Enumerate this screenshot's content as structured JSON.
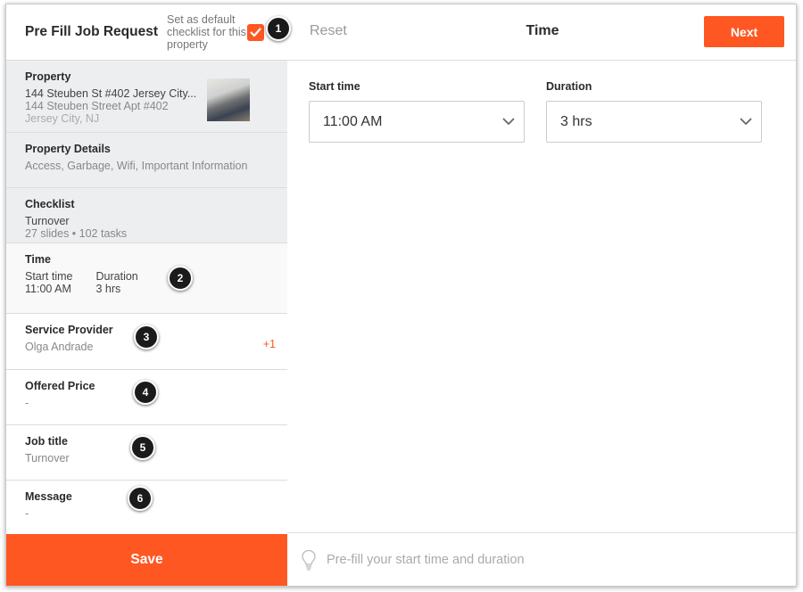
{
  "left": {
    "title": "Pre Fill Job Request",
    "default_checkbox_label": "Set as default checklist for this property",
    "default_checked": true,
    "property": {
      "title": "Property",
      "name": "144 Steuben St #402 Jersey City...",
      "address": "144 Steuben Street Apt #402",
      "city": "Jersey City, NJ"
    },
    "property_details": {
      "title": "Property Details",
      "summary": "Access, Garbage, Wifi, Important Information"
    },
    "checklist": {
      "title": "Checklist",
      "name": "Turnover",
      "summary": "27 slides • 102 tasks"
    },
    "time": {
      "title": "Time",
      "start_label": "Start time",
      "start_value": "11:00 AM",
      "duration_label": "Duration",
      "duration_value": "3 hrs"
    },
    "service_provider": {
      "title": "Service Provider",
      "value": "Olga Andrade",
      "extra_count": "+1"
    },
    "offered_price": {
      "title": "Offered Price",
      "value": "-"
    },
    "job_title": {
      "title": "Job title",
      "value": "Turnover"
    },
    "message": {
      "title": "Message",
      "value": "-"
    },
    "save_label": "Save"
  },
  "right": {
    "reset_label": "Reset",
    "title": "Time",
    "next_label": "Next",
    "start_time": {
      "label": "Start time",
      "value": "11:00 AM"
    },
    "duration": {
      "label": "Duration",
      "value": "3 hrs"
    },
    "tip": "Pre-fill your start time and duration"
  },
  "callouts": [
    "1",
    "2",
    "3",
    "4",
    "5",
    "6"
  ],
  "colors": {
    "accent": "#ff5722",
    "section_gray": "#eceef0",
    "callout": "#1b1b1b"
  }
}
